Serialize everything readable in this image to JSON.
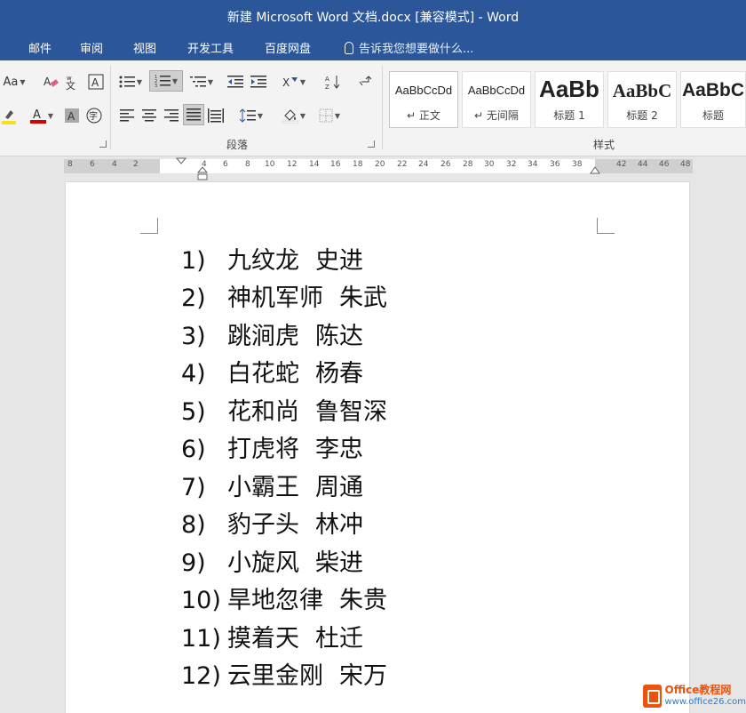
{
  "window": {
    "title": "新建 Microsoft Word 文档.docx [兼容模式] - Word"
  },
  "tabs": [
    {
      "label": "邮件"
    },
    {
      "label": "审阅"
    },
    {
      "label": "视图"
    },
    {
      "label": "开发工具"
    },
    {
      "label": "百度网盘"
    }
  ],
  "tell_me": {
    "placeholder": "告诉我您想要做什么..."
  },
  "ribbon": {
    "font_aa_label": "Aa",
    "paragraph_group_label": "段落",
    "styles_group_label": "样式",
    "styles": [
      {
        "sample": "AaBbCcDd",
        "name": "正文"
      },
      {
        "sample": "AaBbCcDd",
        "name": "无间隔"
      },
      {
        "sample": "AaBb",
        "name": "标题 1"
      },
      {
        "sample": "AaBbC",
        "name": "标题 2"
      },
      {
        "sample": "AaBbC",
        "name": "标题"
      }
    ]
  },
  "ruler": {
    "left_ticks": [
      "8",
      "6",
      "4",
      "2"
    ],
    "ticks": [
      "2",
      "4",
      "6",
      "8",
      "10",
      "12",
      "14",
      "16",
      "18",
      "20",
      "22",
      "24",
      "26",
      "28",
      "30",
      "32",
      "34",
      "36",
      "38"
    ],
    "right_ticks": [
      "42",
      "44",
      "46",
      "48"
    ]
  },
  "document": {
    "items": [
      {
        "num": "1)",
        "nickname": "九纹龙",
        "name": "史进"
      },
      {
        "num": "2)",
        "nickname": "神机军师",
        "name": "朱武"
      },
      {
        "num": "3)",
        "nickname": "跳涧虎",
        "name": "陈达"
      },
      {
        "num": "4)",
        "nickname": "白花蛇",
        "name": "杨春"
      },
      {
        "num": "5)",
        "nickname": "花和尚",
        "name": "鲁智深"
      },
      {
        "num": "6)",
        "nickname": "打虎将",
        "name": "李忠"
      },
      {
        "num": "7)",
        "nickname": "小霸王",
        "name": "周通"
      },
      {
        "num": "8)",
        "nickname": "豹子头",
        "name": "林冲"
      },
      {
        "num": "9)",
        "nickname": "小旋风",
        "name": "柴进"
      },
      {
        "num": "10)",
        "nickname": "旱地忽律",
        "name": "朱贵"
      },
      {
        "num": "11)",
        "nickname": "摸着天",
        "name": "杜迁"
      },
      {
        "num": "12)",
        "nickname": "云里金刚",
        "name": "宋万"
      }
    ]
  },
  "watermark": {
    "brand": "Office教程网",
    "url": "www.office26.com"
  }
}
